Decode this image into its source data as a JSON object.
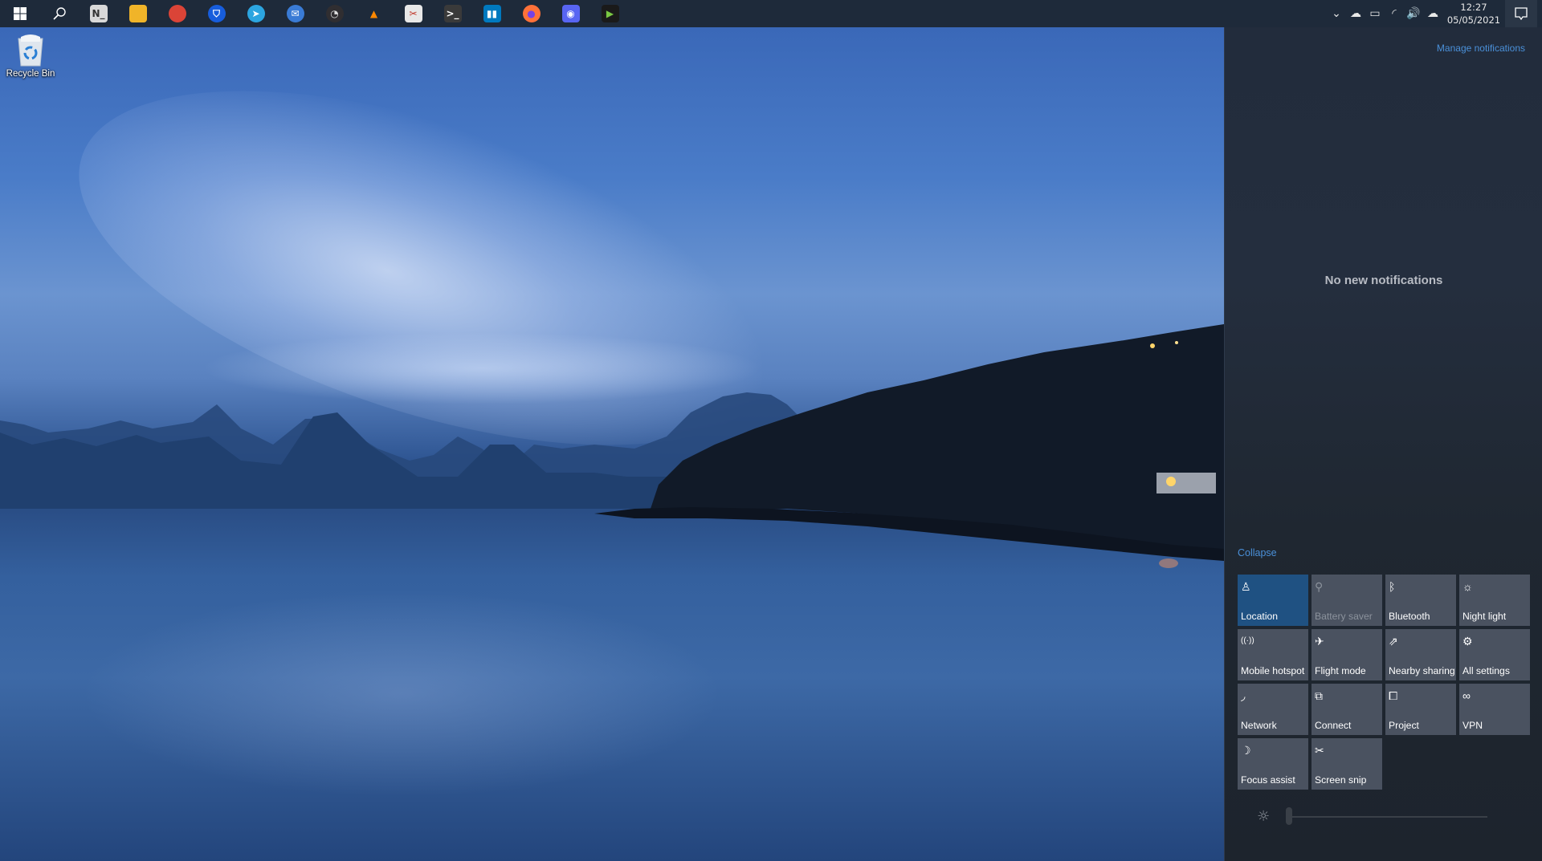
{
  "taskbar": {
    "start": {
      "icon": "windows-logo-icon"
    },
    "search": {
      "icon": "search-icon"
    },
    "pinned": [
      {
        "name": "notepad-app",
        "icon": "notepad-icon",
        "glyph": "N_",
        "color": "#d8d8d8",
        "fg": "#333333"
      },
      {
        "name": "file-explorer",
        "icon": "folder-icon",
        "glyph": "",
        "color": "#f0b429",
        "fg": "#2a6fd6"
      },
      {
        "name": "chrome",
        "icon": "chrome-icon",
        "glyph": "",
        "color": "#db4437",
        "fg": "#ffffff"
      },
      {
        "name": "bitwarden",
        "icon": "bitwarden-icon",
        "glyph": "⛉",
        "color": "#175ddc",
        "fg": "#ffffff"
      },
      {
        "name": "telegram",
        "icon": "telegram-icon",
        "glyph": "➤",
        "color": "#2ca5e0",
        "fg": "#ffffff"
      },
      {
        "name": "thunderbird",
        "icon": "thunderbird-icon",
        "glyph": "✉",
        "color": "#3a7bd5",
        "fg": "#ffffff"
      },
      {
        "name": "obs-studio",
        "icon": "obs-icon",
        "glyph": "◔",
        "color": "#302e31",
        "fg": "#e0e0e0"
      },
      {
        "name": "vlc",
        "icon": "vlc-cone-icon",
        "glyph": "▲",
        "color": "transparent",
        "fg": "#ff8800"
      },
      {
        "name": "snipping-tool",
        "icon": "scissors-icon",
        "glyph": "✂",
        "color": "#e8e8e8",
        "fg": "#c0392b"
      },
      {
        "name": "terminal",
        "icon": "terminal-icon",
        "glyph": ">_",
        "color": "#3a3a3a",
        "fg": "#ffffff"
      },
      {
        "name": "trello",
        "icon": "trello-icon",
        "glyph": "▮▮",
        "color": "#0079bf",
        "fg": "#ffffff"
      },
      {
        "name": "firefox",
        "icon": "firefox-icon",
        "glyph": "●",
        "color": "#ff7139",
        "fg": "#7542e5"
      },
      {
        "name": "discord",
        "icon": "discord-icon",
        "glyph": "◉",
        "color": "#5865f2",
        "fg": "#ffffff"
      },
      {
        "name": "media-player",
        "icon": "play-icon",
        "glyph": "▶",
        "color": "#1a1a1a",
        "fg": "#7ac943"
      }
    ],
    "tray": {
      "icons": [
        {
          "name": "show-hidden-icons",
          "icon": "chevron-up-icon",
          "glyph": "⌄"
        },
        {
          "name": "onedrive",
          "icon": "cloud-icon",
          "glyph": "☁"
        },
        {
          "name": "battery",
          "icon": "battery-charging-icon",
          "glyph": "▭"
        },
        {
          "name": "wifi",
          "icon": "wifi-icon",
          "glyph": "◜"
        },
        {
          "name": "volume",
          "icon": "speaker-icon",
          "glyph": "🔊"
        },
        {
          "name": "cloud-sync",
          "icon": "cloud-upload-icon",
          "glyph": "☁"
        }
      ],
      "time": "12:27",
      "date": "05/05/2021"
    }
  },
  "desktop": {
    "icons": [
      {
        "label": "Recycle Bin",
        "icon": "recycle-bin-icon"
      }
    ]
  },
  "action_center": {
    "manage_label": "Manage notifications",
    "empty_label": "No new notifications",
    "collapse_label": "Collapse",
    "tiles": [
      {
        "label": "Location",
        "icon": "location-icon",
        "glyph": "♙",
        "state": "on"
      },
      {
        "label": "Battery saver",
        "icon": "battery-saver-icon",
        "glyph": "⚲",
        "state": "disabled"
      },
      {
        "label": "Bluetooth",
        "icon": "bluetooth-icon",
        "glyph": "ᛒ",
        "state": "off"
      },
      {
        "label": "Night light",
        "icon": "night-light-icon",
        "glyph": "☼",
        "state": "off"
      },
      {
        "label": "Mobile hotspot",
        "icon": "hotspot-icon",
        "glyph": "((·))",
        "state": "off"
      },
      {
        "label": "Flight mode",
        "icon": "airplane-icon",
        "glyph": "✈",
        "state": "off"
      },
      {
        "label": "Nearby sharing",
        "icon": "nearby-sharing-icon",
        "glyph": "⇗",
        "state": "off"
      },
      {
        "label": "All settings",
        "icon": "gear-icon",
        "glyph": "⚙",
        "state": "off"
      },
      {
        "label": "Network",
        "icon": "network-icon",
        "glyph": "◞",
        "state": "off"
      },
      {
        "label": "Connect",
        "icon": "connect-icon",
        "glyph": "⧉",
        "state": "off"
      },
      {
        "label": "Project",
        "icon": "project-icon",
        "glyph": "⧠",
        "state": "off"
      },
      {
        "label": "VPN",
        "icon": "vpn-icon",
        "glyph": "∞",
        "state": "off"
      },
      {
        "label": "Focus assist",
        "icon": "moon-icon",
        "glyph": "☽",
        "state": "off"
      },
      {
        "label": "Screen snip",
        "icon": "screen-snip-icon",
        "glyph": "✂",
        "state": "off"
      }
    ],
    "brightness": {
      "icon": "brightness-icon",
      "level_percent": 0
    }
  },
  "colors": {
    "accent": "#1f5182",
    "link": "#4a90d9",
    "tile": "#4a5260",
    "taskbar": "#1e2a3a"
  }
}
